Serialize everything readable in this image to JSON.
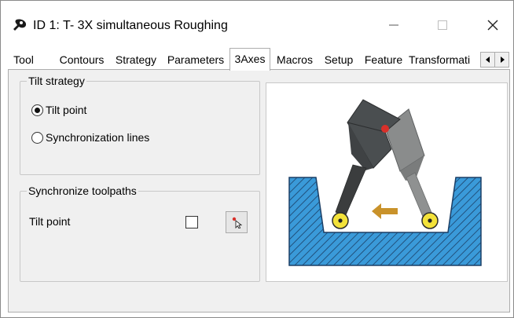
{
  "window": {
    "title": "ID 1: T- 3X simultaneous Roughing",
    "icon": "app-logo-icon",
    "controls": [
      "minimize-icon",
      "maximize-icon",
      "close-icon"
    ]
  },
  "tabs": {
    "items": [
      {
        "label": "Tool"
      },
      {
        "label": "Contours"
      },
      {
        "label": "Strategy"
      },
      {
        "label": "Parameters"
      },
      {
        "label": "3Axes",
        "active": true
      },
      {
        "label": "Macros"
      },
      {
        "label": "Setup"
      },
      {
        "label": "Feature"
      },
      {
        "label": "Transformati"
      }
    ],
    "scroll_left_icon": "triangle-left-icon",
    "scroll_right_icon": "triangle-right-icon"
  },
  "tilt_strategy": {
    "title": "Tilt strategy",
    "options": [
      {
        "label": "Tilt point",
        "selected": true
      },
      {
        "label": "Synchronization lines",
        "selected": false
      }
    ]
  },
  "synchronize": {
    "title": "Synchronize toolpaths",
    "tilt_point_label": "Tilt point",
    "checked": false,
    "pick_icon": "pick-cursor-icon"
  },
  "diagram": {
    "colors": {
      "workpiece_fill": "#3a9ad9",
      "hatch": "#1b3f66",
      "tool_dark": "#4a4e50",
      "tool_light": "#8a8c8c",
      "arm": "#3b3d3e",
      "contact_point": "#f3e23a",
      "arrow": "#c9922a",
      "tilt_marker": "#d9302a"
    }
  }
}
